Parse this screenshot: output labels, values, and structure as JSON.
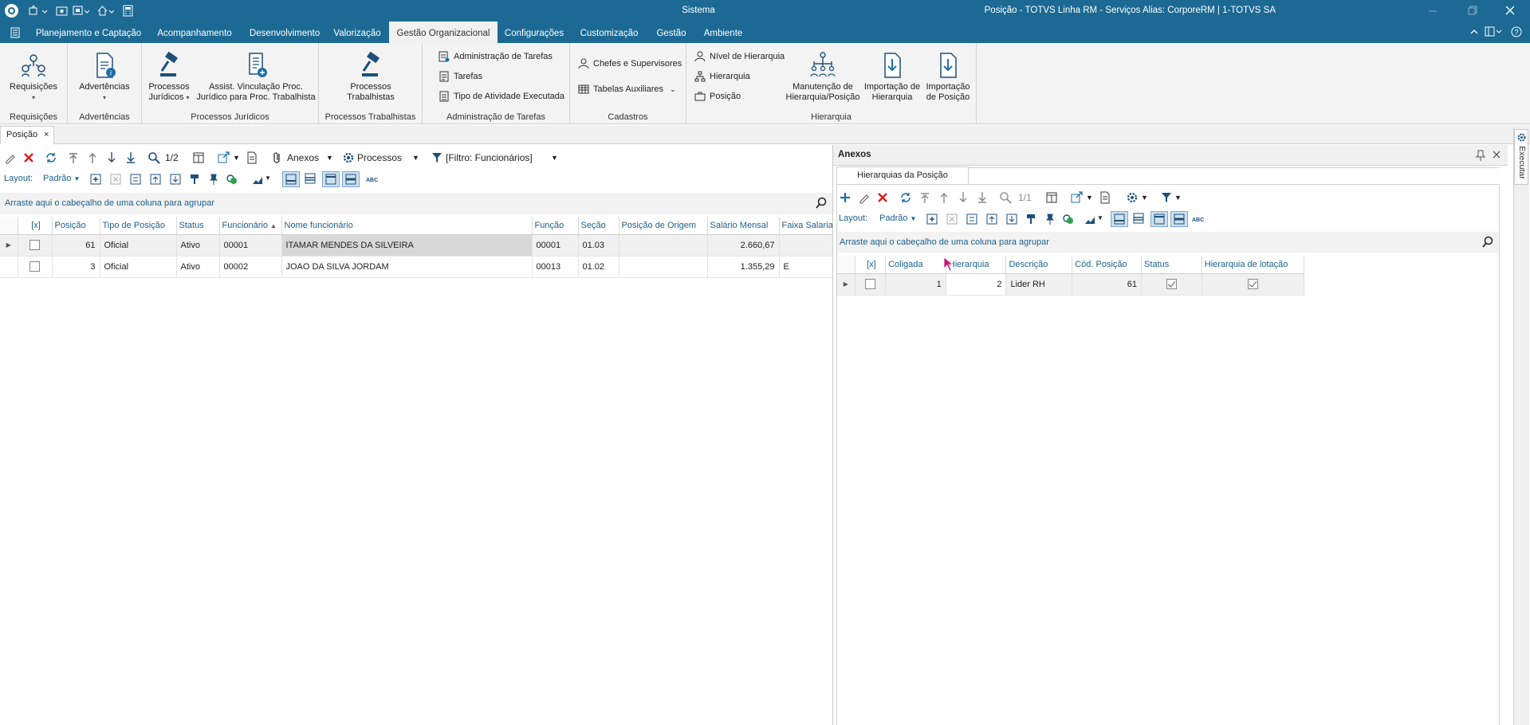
{
  "title_bar": {
    "center": "Sistema",
    "title": "Posição - TOTVS Linha RM - Serviços  Alias: CorporeRM | 1-TOTVS SA"
  },
  "menu_tabs": [
    "Planejamento e Captação",
    "Acompanhamento",
    "Desenvolvimento",
    "Valorização",
    "Gestão Organizacional",
    "Configurações",
    "Customização",
    "Gestão",
    "Ambiente"
  ],
  "ribbon": {
    "requisicoes": {
      "button": "Requisições",
      "group": "Requisições"
    },
    "advertencias": {
      "button": "Advertências",
      "group": "Advertências"
    },
    "processos_juridicos": {
      "btn1_l1": "Processos",
      "btn1_l2": "Jurídicos",
      "btn2_l1": "Assist. Vinculação Proc.",
      "btn2_l2": "Jurídico para Proc. Trabalhista",
      "group": "Processos Jurídicos"
    },
    "processos_trabalhistas": {
      "btn_l1": "Processos",
      "btn_l2": "Trabalhistas",
      "group": "Processos Trabalhistas"
    },
    "administracao": {
      "items": [
        "Administração de Tarefas",
        "Tarefas",
        "Tipo de Atividade Executada"
      ],
      "group": "Administração de Tarefas"
    },
    "cadastros": {
      "items": [
        "Chefes e Supervisores",
        "Tabelas Auxiliares"
      ],
      "group": "Cadastros"
    },
    "hierarquia": {
      "items": [
        "Nível de Hierarquia",
        "Hierarquia",
        "Posição"
      ],
      "btn1_l1": "Manutenção de",
      "btn1_l2": "Hierarquia/Posição",
      "btn2_l1": "Importação de",
      "btn2_l2": "Hierarquia",
      "btn3_l1": "Importação",
      "btn3_l2": "de Posição",
      "group": "Hierarquia"
    }
  },
  "doc_tab": "Posição",
  "left_toolbar": {
    "count": "1/2",
    "anexos": "Anexos",
    "processos": "Processos",
    "filtro": "[Filtro: Funcionários]",
    "layout_label": "Layout:",
    "layout_value": "Padrão"
  },
  "left_group_hint": "Arraste aqui o cabeçalho de uma coluna para agrupar",
  "left_grid": {
    "columns": [
      "[x]",
      "Posição",
      "Tipo de Posição",
      "Status",
      "Funcionário",
      "Nome funcionário",
      "Função",
      "Seção",
      "Posição de Origem",
      "Salário Mensal",
      "Faixa Salaria"
    ],
    "rows": [
      {
        "posicao": "61",
        "tipo": "Oficial",
        "status": "Ativo",
        "funcionario": "00001",
        "nome": "ITAMAR MENDES DA SILVEIRA",
        "funcao": "00001",
        "secao": "01.03",
        "origem": "",
        "salario": "2.660,67",
        "faixa": ""
      },
      {
        "posicao": "3",
        "tipo": "Oficial",
        "status": "Ativo",
        "funcionario": "00002",
        "nome": "JOAO DA SILVA JORDAM",
        "funcao": "00013",
        "secao": "01.02",
        "origem": "",
        "salario": "1.355,29",
        "faixa": "E"
      }
    ]
  },
  "right_panel": {
    "title": "Anexos",
    "tab": "Hierarquias da Posição",
    "count": "1/1",
    "layout_label": "Layout:",
    "layout_value": "Padrão",
    "group_hint": "Arraste aqui o cabeçalho de uma coluna para agrupar",
    "columns": [
      "[x]",
      "Coligada",
      "Hierarquia",
      "Descrição",
      "Cód. Posição",
      "Status",
      "Hierarquia de lotação"
    ],
    "rows": [
      {
        "coligada": "1",
        "hierarquia": "2",
        "descricao": "Lider RH",
        "cod_posicao": "61"
      }
    ]
  },
  "side_tab": "Executar"
}
